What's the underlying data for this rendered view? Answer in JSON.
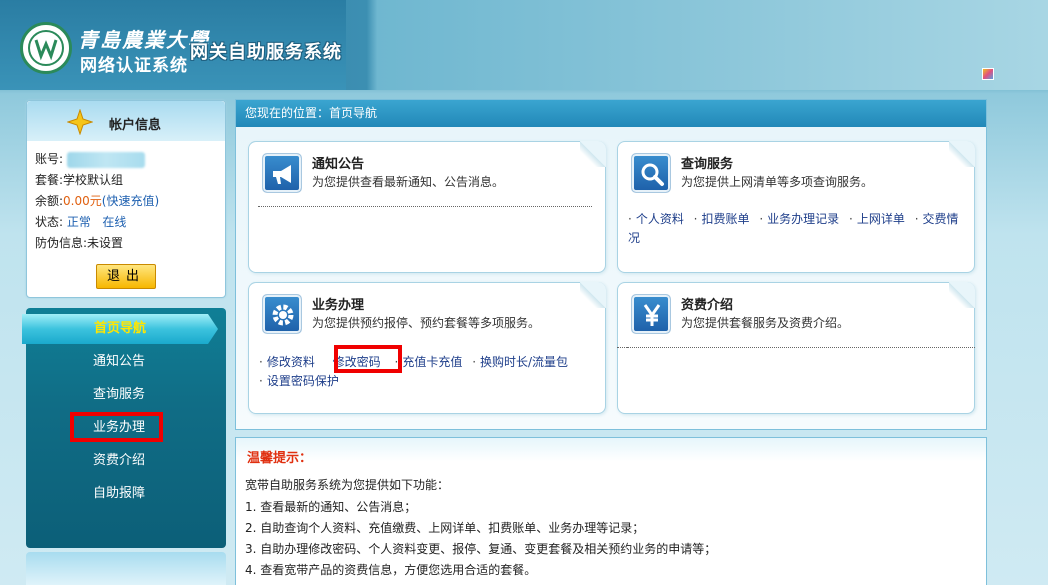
{
  "header": {
    "university": "青島農業大學",
    "system_name": "网络认证系统",
    "system_title": "网关自助服务系统"
  },
  "account": {
    "title": "帐户信息",
    "account_label": "账号:",
    "package_label": "套餐:",
    "package_value": "学校默认组",
    "balance_label": "余额:",
    "balance_value": "0.00元",
    "recharge_link": "(快速充值)",
    "status_label": "状态:",
    "status_value": "正常",
    "online_value": "在线",
    "anti_fraud_label": "防伪信息:",
    "anti_fraud_value": "未设置",
    "logout_label": "退出"
  },
  "nav": {
    "items": [
      {
        "label": "首页导航"
      },
      {
        "label": "通知公告"
      },
      {
        "label": "查询服务"
      },
      {
        "label": "业务办理"
      },
      {
        "label": "资费介绍"
      },
      {
        "label": "自助报障"
      }
    ]
  },
  "main": {
    "location": "您现在的位置：首页导航",
    "cards": [
      {
        "title": "通知公告",
        "desc": "为您提供查看最新通知、公告消息。",
        "links": []
      },
      {
        "title": "查询服务",
        "desc": "为您提供上网清单等多项查询服务。",
        "links": [
          "个人资料",
          "扣费账单",
          "业务办理记录",
          "上网详单",
          "交费情况"
        ]
      },
      {
        "title": "业务办理",
        "desc": "为您提供预约报停、预约套餐等多项服务。",
        "links": [
          "修改资料",
          "修改密码",
          "充值卡充值",
          "换购时长/流量包",
          "设置密码保护"
        ]
      },
      {
        "title": "资费介绍",
        "desc": "为您提供套餐服务及资费介绍。",
        "links": []
      }
    ]
  },
  "tips": {
    "title": "温馨提示：",
    "intro": "宽带自助服务系统为您提供如下功能：",
    "items": [
      "1. 查看最新的通知、公告消息；",
      "2. 自助查询个人资料、充值缴费、上网详单、扣费账单、业务办理等记录；",
      "3. 自助办理修改密码、个人资料变更、报停、复通、变更套餐及相关预约业务的申请等；",
      "4. 查看宽带产品的资费信息，方便您选用合适的套餐。"
    ]
  },
  "colors": {
    "nav_bg": "#106d86",
    "nav_active_text": "#ffe600",
    "highlight_red": "#f00000",
    "location_bar": "#2288b8",
    "tips_title": "#e03010"
  }
}
